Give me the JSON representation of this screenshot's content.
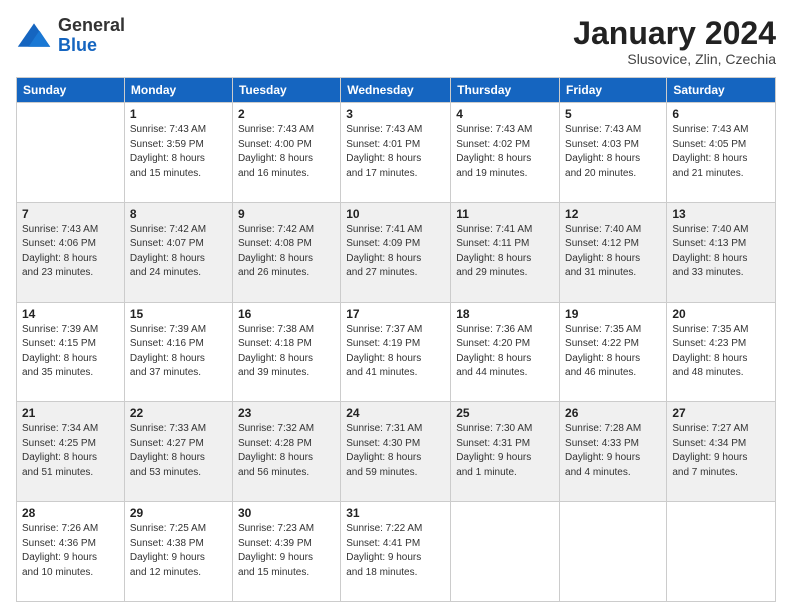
{
  "header": {
    "logo_line1": "General",
    "logo_line2": "Blue",
    "month": "January 2024",
    "location": "Slusovice, Zlin, Czechia"
  },
  "weekdays": [
    "Sunday",
    "Monday",
    "Tuesday",
    "Wednesday",
    "Thursday",
    "Friday",
    "Saturday"
  ],
  "weeks": [
    [
      {
        "day": "",
        "info": ""
      },
      {
        "day": "1",
        "info": "Sunrise: 7:43 AM\nSunset: 3:59 PM\nDaylight: 8 hours\nand 15 minutes."
      },
      {
        "day": "2",
        "info": "Sunrise: 7:43 AM\nSunset: 4:00 PM\nDaylight: 8 hours\nand 16 minutes."
      },
      {
        "day": "3",
        "info": "Sunrise: 7:43 AM\nSunset: 4:01 PM\nDaylight: 8 hours\nand 17 minutes."
      },
      {
        "day": "4",
        "info": "Sunrise: 7:43 AM\nSunset: 4:02 PM\nDaylight: 8 hours\nand 19 minutes."
      },
      {
        "day": "5",
        "info": "Sunrise: 7:43 AM\nSunset: 4:03 PM\nDaylight: 8 hours\nand 20 minutes."
      },
      {
        "day": "6",
        "info": "Sunrise: 7:43 AM\nSunset: 4:05 PM\nDaylight: 8 hours\nand 21 minutes."
      }
    ],
    [
      {
        "day": "7",
        "info": "Sunrise: 7:43 AM\nSunset: 4:06 PM\nDaylight: 8 hours\nand 23 minutes."
      },
      {
        "day": "8",
        "info": "Sunrise: 7:42 AM\nSunset: 4:07 PM\nDaylight: 8 hours\nand 24 minutes."
      },
      {
        "day": "9",
        "info": "Sunrise: 7:42 AM\nSunset: 4:08 PM\nDaylight: 8 hours\nand 26 minutes."
      },
      {
        "day": "10",
        "info": "Sunrise: 7:41 AM\nSunset: 4:09 PM\nDaylight: 8 hours\nand 27 minutes."
      },
      {
        "day": "11",
        "info": "Sunrise: 7:41 AM\nSunset: 4:11 PM\nDaylight: 8 hours\nand 29 minutes."
      },
      {
        "day": "12",
        "info": "Sunrise: 7:40 AM\nSunset: 4:12 PM\nDaylight: 8 hours\nand 31 minutes."
      },
      {
        "day": "13",
        "info": "Sunrise: 7:40 AM\nSunset: 4:13 PM\nDaylight: 8 hours\nand 33 minutes."
      }
    ],
    [
      {
        "day": "14",
        "info": "Sunrise: 7:39 AM\nSunset: 4:15 PM\nDaylight: 8 hours\nand 35 minutes."
      },
      {
        "day": "15",
        "info": "Sunrise: 7:39 AM\nSunset: 4:16 PM\nDaylight: 8 hours\nand 37 minutes."
      },
      {
        "day": "16",
        "info": "Sunrise: 7:38 AM\nSunset: 4:18 PM\nDaylight: 8 hours\nand 39 minutes."
      },
      {
        "day": "17",
        "info": "Sunrise: 7:37 AM\nSunset: 4:19 PM\nDaylight: 8 hours\nand 41 minutes."
      },
      {
        "day": "18",
        "info": "Sunrise: 7:36 AM\nSunset: 4:20 PM\nDaylight: 8 hours\nand 44 minutes."
      },
      {
        "day": "19",
        "info": "Sunrise: 7:35 AM\nSunset: 4:22 PM\nDaylight: 8 hours\nand 46 minutes."
      },
      {
        "day": "20",
        "info": "Sunrise: 7:35 AM\nSunset: 4:23 PM\nDaylight: 8 hours\nand 48 minutes."
      }
    ],
    [
      {
        "day": "21",
        "info": "Sunrise: 7:34 AM\nSunset: 4:25 PM\nDaylight: 8 hours\nand 51 minutes."
      },
      {
        "day": "22",
        "info": "Sunrise: 7:33 AM\nSunset: 4:27 PM\nDaylight: 8 hours\nand 53 minutes."
      },
      {
        "day": "23",
        "info": "Sunrise: 7:32 AM\nSunset: 4:28 PM\nDaylight: 8 hours\nand 56 minutes."
      },
      {
        "day": "24",
        "info": "Sunrise: 7:31 AM\nSunset: 4:30 PM\nDaylight: 8 hours\nand 59 minutes."
      },
      {
        "day": "25",
        "info": "Sunrise: 7:30 AM\nSunset: 4:31 PM\nDaylight: 9 hours\nand 1 minute."
      },
      {
        "day": "26",
        "info": "Sunrise: 7:28 AM\nSunset: 4:33 PM\nDaylight: 9 hours\nand 4 minutes."
      },
      {
        "day": "27",
        "info": "Sunrise: 7:27 AM\nSunset: 4:34 PM\nDaylight: 9 hours\nand 7 minutes."
      }
    ],
    [
      {
        "day": "28",
        "info": "Sunrise: 7:26 AM\nSunset: 4:36 PM\nDaylight: 9 hours\nand 10 minutes."
      },
      {
        "day": "29",
        "info": "Sunrise: 7:25 AM\nSunset: 4:38 PM\nDaylight: 9 hours\nand 12 minutes."
      },
      {
        "day": "30",
        "info": "Sunrise: 7:23 AM\nSunset: 4:39 PM\nDaylight: 9 hours\nand 15 minutes."
      },
      {
        "day": "31",
        "info": "Sunrise: 7:22 AM\nSunset: 4:41 PM\nDaylight: 9 hours\nand 18 minutes."
      },
      {
        "day": "",
        "info": ""
      },
      {
        "day": "",
        "info": ""
      },
      {
        "day": "",
        "info": ""
      }
    ]
  ]
}
